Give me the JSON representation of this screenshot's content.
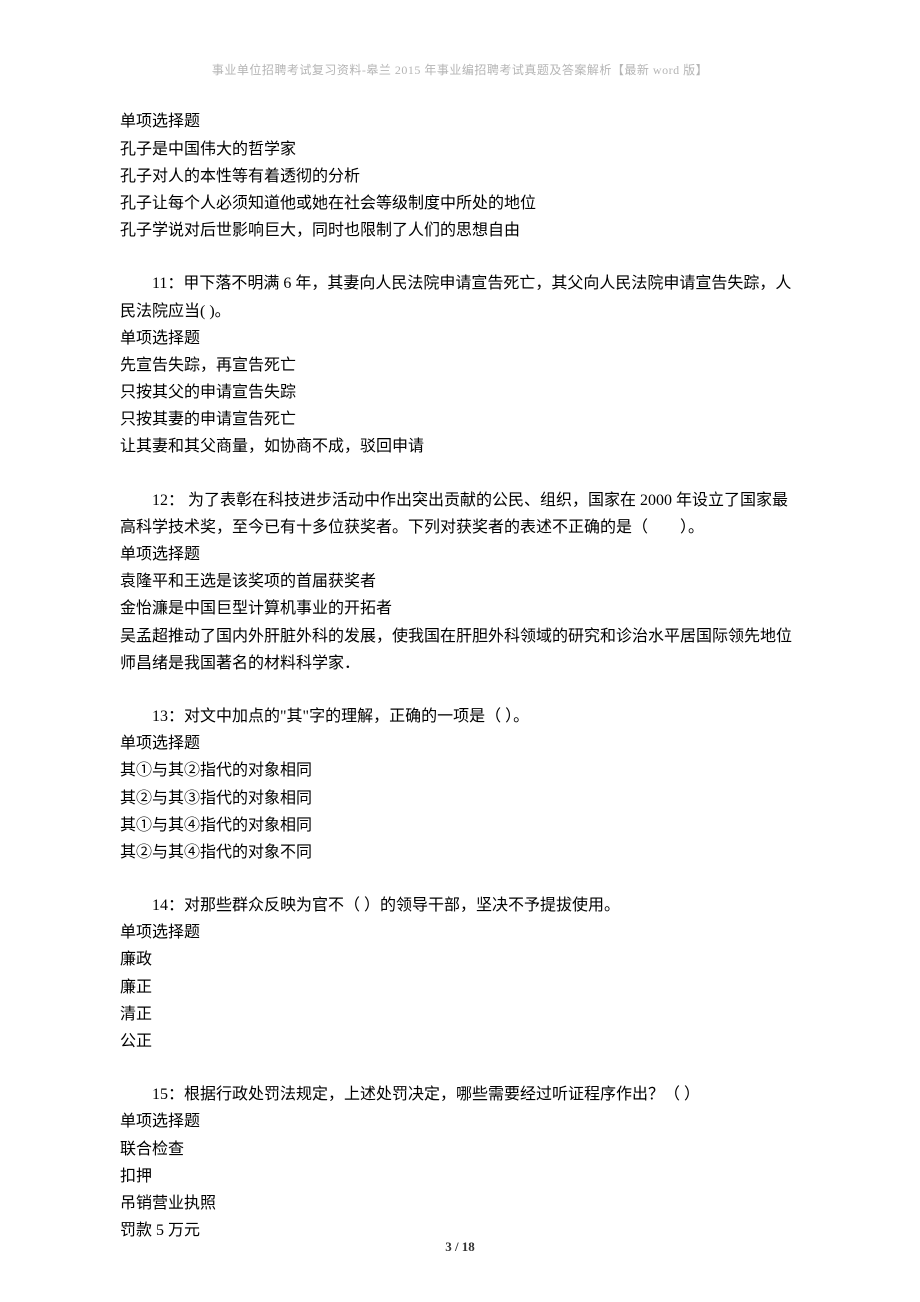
{
  "header": "事业单位招聘考试复习资料-皋兰 2015 年事业编招聘考试真题及答案解析【最新 word 版】",
  "q10": {
    "type": "单项选择题",
    "o1": "孔子是中国伟大的哲学家",
    "o2": "孔子对人的本性等有着透彻的分析",
    "o3": "孔子让每个人必须知道他或她在社会等级制度中所处的地位",
    "o4": "孔子学说对后世影响巨大，同时也限制了人们的思想自由"
  },
  "q11": {
    "stem": "11：甲下落不明满 6 年，其妻向人民法院申请宣告死亡，其父向人民法院申请宣告失踪，人民法院应当(  )。",
    "type": "单项选择题",
    "o1": "先宣告失踪，再宣告死亡",
    "o2": "只按其父的申请宣告失踪",
    "o3": "只按其妻的申请宣告死亡",
    "o4": "让其妻和其父商量，如协商不成，驳回申请"
  },
  "q12": {
    "stem": "12： 为了表彰在科技进步活动中作出突出贡献的公民、组织，国家在 2000 年设立了国家最高科学技术奖，至今已有十多位获奖者。下列对获奖者的表述不正确的是（　　）。",
    "type": "单项选择题",
    "o1": "袁隆平和王选是该奖项的首届获奖者",
    "o2": "金怡濂是中国巨型计算机事业的开拓者",
    "o3": "吴孟超推动了国内外肝脏外科的发展，使我国在肝胆外科领域的研究和诊治水平居国际领先地位",
    "o4": "师昌绪是我国著名的材料科学家．"
  },
  "q13": {
    "stem": "13：对文中加点的\"其\"字的理解，正确的一项是（  ）。",
    "type": "单项选择题",
    "o1": "其①与其②指代的对象相同",
    "o2": "其②与其③指代的对象相同",
    "o3": "其①与其④指代的对象相同",
    "o4": "其②与其④指代的对象不同"
  },
  "q14": {
    "stem": "14：对那些群众反映为官不（  ）的领导干部，坚决不予提拔使用。",
    "type": "单项选择题",
    "o1": "廉政",
    "o2": "廉正",
    "o3": "清正",
    "o4": "公正"
  },
  "q15": {
    "stem": "15：根据行政处罚法规定，上述处罚决定，哪些需要经过听证程序作出？（  ）",
    "type": "单项选择题",
    "o1": "联合检查",
    "o2": "扣押",
    "o3": "吊销营业执照",
    "o4": "罚款 5 万元"
  },
  "footer": "3 / 18"
}
